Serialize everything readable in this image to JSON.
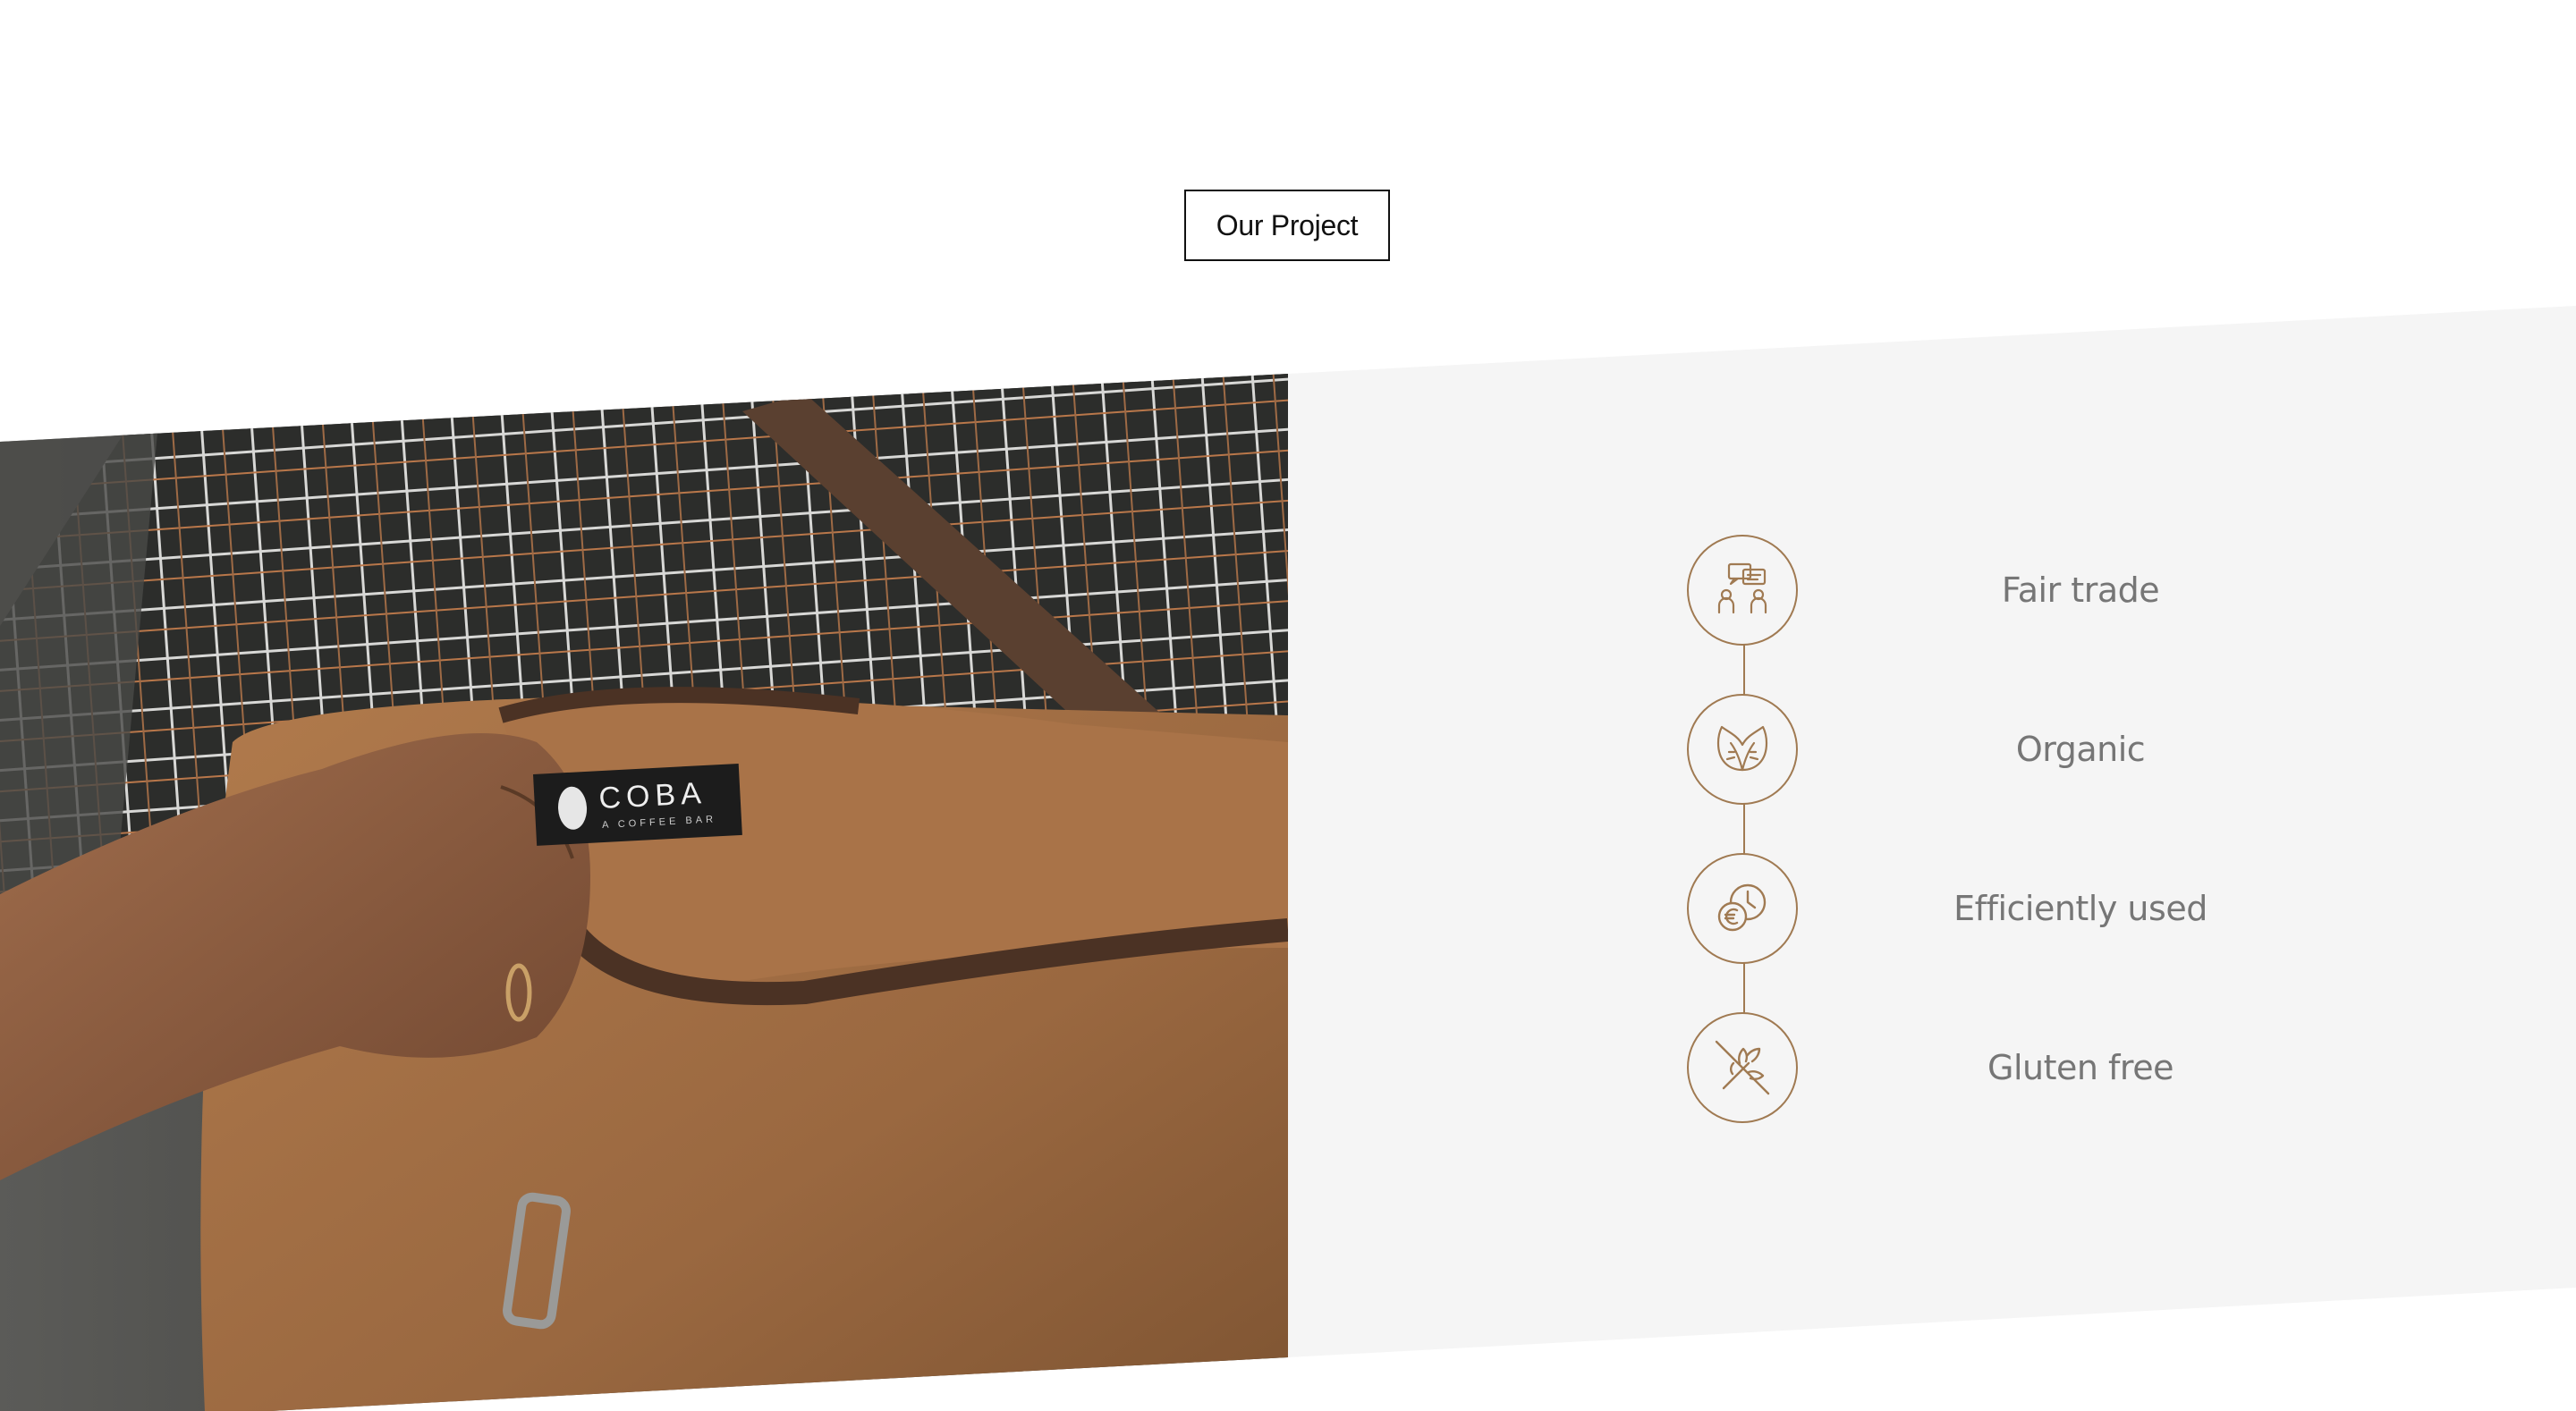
{
  "section": {
    "button_label": "Our Project"
  },
  "photo": {
    "brand_name": "COBA",
    "brand_tagline": "A COFFEE BAR"
  },
  "features": [
    {
      "label": "Fair trade",
      "icon": "people-dialogue-icon"
    },
    {
      "label": "Organic",
      "icon": "leaf-icon"
    },
    {
      "label": "Efficiently used",
      "icon": "euro-clock-icon"
    },
    {
      "label": "Gluten free",
      "icon": "no-wheat-icon"
    }
  ],
  "colors": {
    "accent": "#a07a52",
    "band": "#f5f5f5",
    "label_text": "#767676"
  }
}
